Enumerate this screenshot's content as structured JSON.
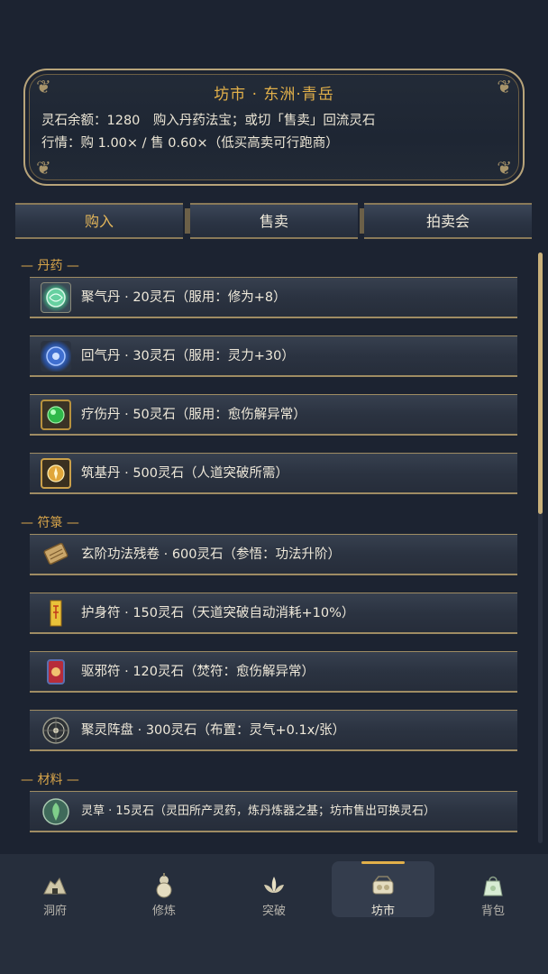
{
  "header": {
    "title": "坊市 · 东洲·青岳",
    "line1": "灵石余额：1280　购入丹药法宝；或切「售卖」回流灵石",
    "line2": "行情：购 1.00× / 售 0.60×（低买高卖可行跑商）"
  },
  "tabs": [
    {
      "label": "购入",
      "active": true
    },
    {
      "label": "售卖",
      "active": false
    },
    {
      "label": "拍卖会",
      "active": false
    }
  ],
  "sections": [
    {
      "title": "— 丹药 —",
      "items": [
        {
          "label": "聚气丹 · 20灵石（服用：修为+8）",
          "icon": "green-pill-icon"
        },
        {
          "label": "回气丹 · 30灵石（服用：灵力+30）",
          "icon": "blue-pill-icon"
        },
        {
          "label": "疗伤丹 · 50灵石（服用：愈伤解异常）",
          "icon": "healing-pill-icon"
        },
        {
          "label": "筑基丹 · 500灵石（人道突破所需）",
          "icon": "gold-pill-icon"
        }
      ]
    },
    {
      "title": "— 符箓 —",
      "items": [
        {
          "label": "玄阶功法残卷 · 600灵石（参悟：功法升阶）",
          "icon": "scroll-icon"
        },
        {
          "label": "护身符 · 150灵石（天道突破自动消耗+10%）",
          "icon": "talisman-icon"
        },
        {
          "label": "驱邪符 · 120灵石（焚符：愈伤解异常）",
          "icon": "exorcism-talisman-icon"
        },
        {
          "label": "聚灵阵盘 · 300灵石（布置：灵气+0.1x/张）",
          "icon": "array-disk-icon"
        }
      ]
    },
    {
      "title": "— 材料 —",
      "items": [
        {
          "label": "灵草 · 15灵石（灵田所产灵药，炼丹炼器之基；坊市售出可换灵石）",
          "icon": "herb-icon"
        }
      ]
    }
  ],
  "nav": [
    {
      "label": "洞府",
      "icon": "cave-icon",
      "active": false
    },
    {
      "label": "修炼",
      "icon": "gourd-icon",
      "active": false
    },
    {
      "label": "突破",
      "icon": "lotus-icon",
      "active": false
    },
    {
      "label": "坊市",
      "icon": "market-icon",
      "active": true
    },
    {
      "label": "背包",
      "icon": "bag-icon",
      "active": false
    }
  ],
  "colors": {
    "accent_gold": "#e2b04a",
    "border_gold": "#9f8c63",
    "background": "#1c2331"
  }
}
